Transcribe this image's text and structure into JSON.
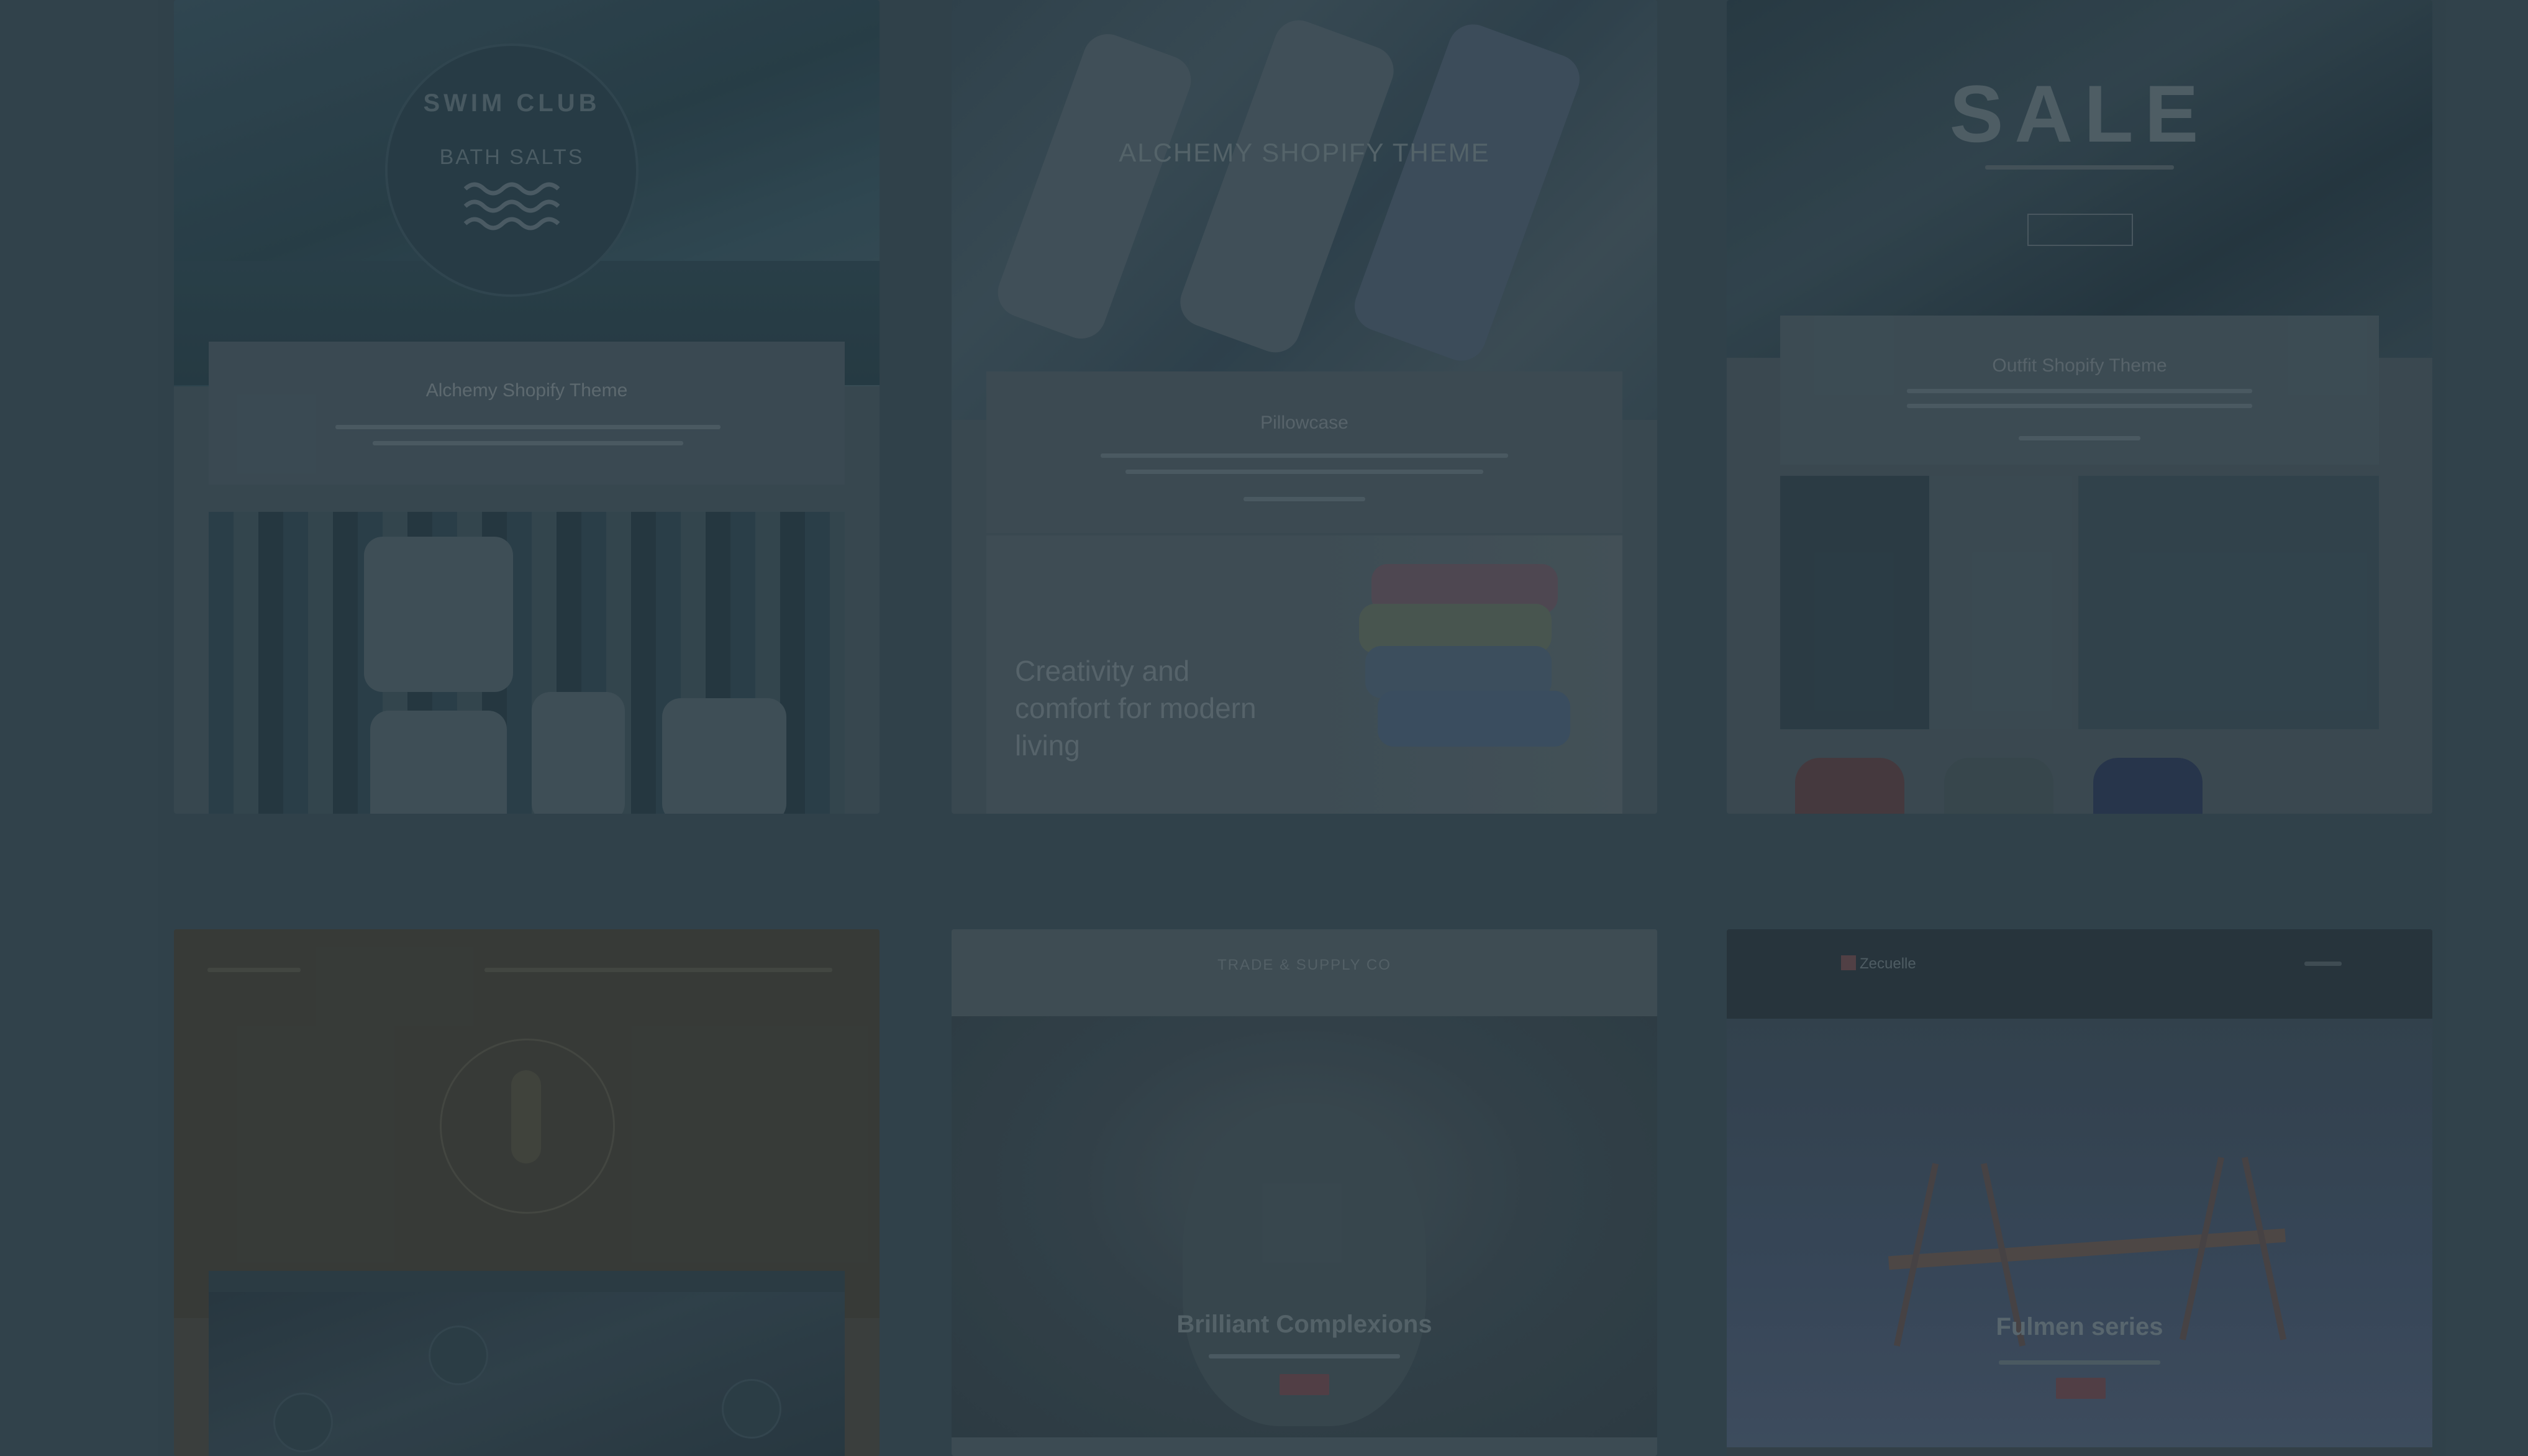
{
  "gallery": {
    "cards": [
      {
        "hero_brand": "SWIM CLUB",
        "hero_product": "BATH SALTS",
        "title": "Alchemy Shopify Theme"
      },
      {
        "hero_title": "ALCHEMY SHOPIFY THEME",
        "title": "Pillowcase",
        "tagline": "Creativity and comfort for modern living"
      },
      {
        "hero_title": "SALE",
        "title": "Outfit Shopify Theme"
      },
      {},
      {
        "brand": "TRADE & SUPPLY CO",
        "title": "Brilliant Complexions"
      },
      {
        "brand": "Zecuelle",
        "title": "Fulmen series"
      }
    ]
  },
  "colors": {
    "overlay": "#162630",
    "background": "#3c4e57",
    "accent_button": "#6a4a4f"
  },
  "icons": [
    "waves-icon",
    "logo-emblem-icon",
    "brand-mark-icon"
  ]
}
